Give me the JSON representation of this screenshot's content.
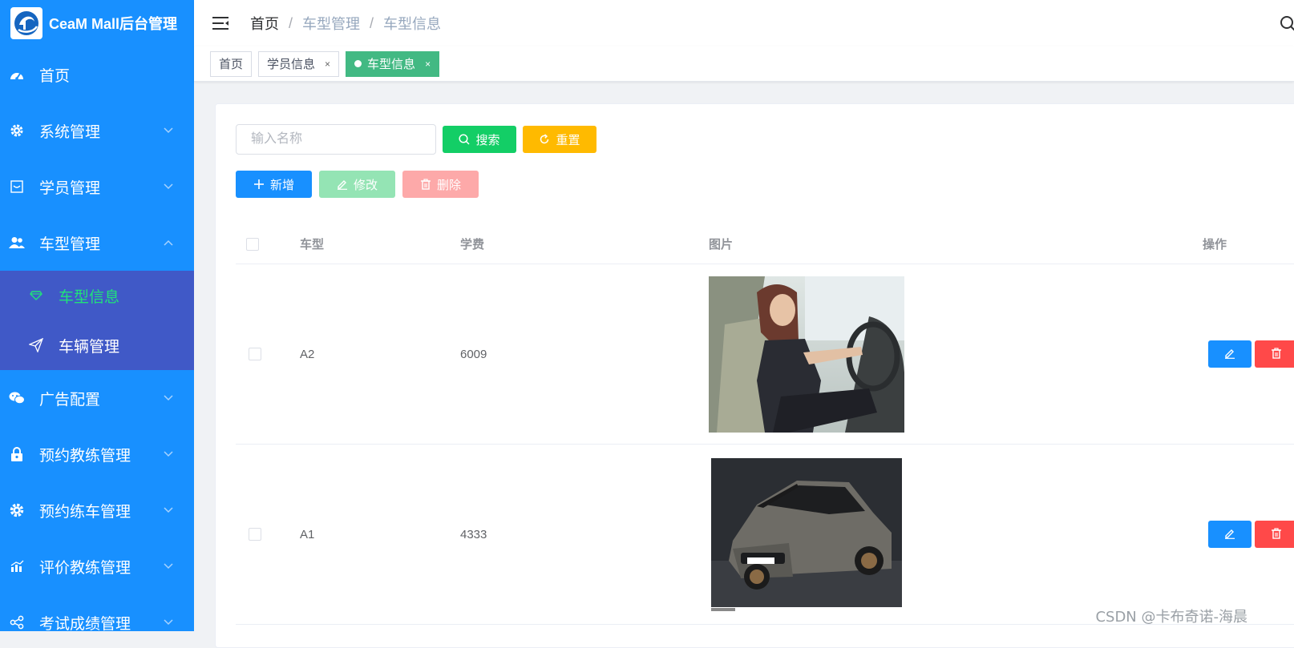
{
  "app": {
    "title": "CeaM Mall后台管理"
  },
  "sidebar": {
    "items": [
      {
        "label": "首页",
        "icon": "dashboard-icon"
      },
      {
        "label": "系统管理",
        "icon": "gear-icon"
      },
      {
        "label": "学员管理",
        "icon": "inbox-icon"
      },
      {
        "label": "车型管理",
        "icon": "users-icon",
        "expanded": true
      },
      {
        "label": "广告配置",
        "icon": "wechat-icon"
      },
      {
        "label": "预约教练管理",
        "icon": "lock-icon"
      },
      {
        "label": "预约练车管理",
        "icon": "cog-icon"
      },
      {
        "label": "评价教练管理",
        "icon": "chart-icon"
      },
      {
        "label": "考试成绩管理",
        "icon": "share-icon"
      }
    ],
    "subitems": [
      {
        "label": "车型信息",
        "icon": "diamond-icon",
        "active": true
      },
      {
        "label": "车辆管理",
        "icon": "send-icon"
      }
    ]
  },
  "breadcrumb": {
    "home": "首页",
    "items": [
      "车型管理",
      "车型信息"
    ],
    "separator": "/"
  },
  "tags": [
    {
      "label": "首页",
      "closable": false
    },
    {
      "label": "学员信息",
      "closable": true
    },
    {
      "label": "车型信息",
      "closable": true,
      "active": true
    }
  ],
  "tag_close_glyph": "×",
  "search": {
    "placeholder": "输入名称",
    "value": ""
  },
  "buttons": {
    "search": "搜索",
    "reset": "重置",
    "add": "新增",
    "edit": "修改",
    "delete": "删除"
  },
  "table": {
    "columns": [
      "车型",
      "学费",
      "图片",
      "操作"
    ],
    "rows": [
      {
        "type": "A2",
        "fee": "6009",
        "image": "woman-driving-car-photo"
      },
      {
        "type": "A1",
        "fee": "4333",
        "image": "grey-hatchback-car-photo"
      }
    ]
  },
  "watermark": "CSDN @卡布奇诺-海晨",
  "colors": {
    "sidebar": "#1890ff",
    "submenu": "#4059c7",
    "active_submenu_text": "#20e27a",
    "active_tag": "#42b983",
    "search_button": "#13ce66",
    "reset_button": "#ffba00",
    "add_button": "#1890ff",
    "edit_button_disabled": "#94e4b4",
    "delete_button_disabled": "#fda9a9",
    "row_edit": "#1890ff",
    "row_delete": "#ff4949"
  }
}
